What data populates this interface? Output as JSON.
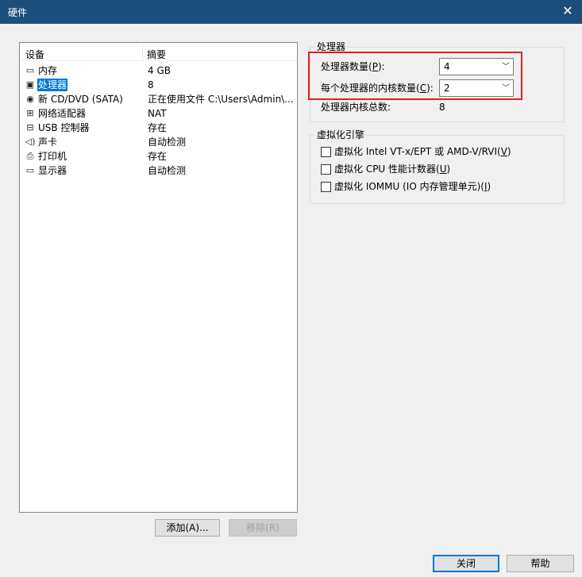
{
  "window": {
    "title": "硬件",
    "close_glyph": "✕"
  },
  "device_table": {
    "col_device": "设备",
    "col_summary": "摘要",
    "rows": [
      {
        "icon": "memory-icon",
        "glyph": "▭",
        "name": "内存",
        "summary": "4 GB",
        "selected": false
      },
      {
        "icon": "cpu-icon",
        "glyph": "▣",
        "name": "处理器",
        "summary": "8",
        "selected": true
      },
      {
        "icon": "cd-dvd-icon",
        "glyph": "◉",
        "name": "新 CD/DVD (SATA)",
        "summary": "正在使用文件 C:\\Users\\Admin\\...",
        "selected": false
      },
      {
        "icon": "network-adapter-icon",
        "glyph": "⊞",
        "name": "网络适配器",
        "summary": "NAT",
        "selected": false
      },
      {
        "icon": "usb-controller-icon",
        "glyph": "⊟",
        "name": "USB 控制器",
        "summary": "存在",
        "selected": false
      },
      {
        "icon": "sound-card-icon",
        "glyph": "◁)",
        "name": "声卡",
        "summary": "自动检测",
        "selected": false
      },
      {
        "icon": "printer-icon",
        "glyph": "⎙",
        "name": "打印机",
        "summary": "存在",
        "selected": false
      },
      {
        "icon": "display-icon",
        "glyph": "▭",
        "name": "显示器",
        "summary": "自动检测",
        "selected": false
      }
    ]
  },
  "buttons": {
    "add": "添加(A)...",
    "remove": "移除(R)",
    "close": "关闭",
    "help": "帮助"
  },
  "processor_group": {
    "legend": "处理器",
    "count_label_pre": "处理器数量(",
    "count_label_key": "P",
    "count_label_post": "):",
    "count_value": "4",
    "cores_label_pre": "每个处理器的内核数量(",
    "cores_label_key": "C",
    "cores_label_post": "):",
    "cores_value": "2",
    "total_label": "处理器内核总数:",
    "total_value": "8"
  },
  "virtualization_group": {
    "legend": "虚拟化引擎",
    "options": [
      {
        "pre": "虚拟化 Intel VT-x/EPT 或 AMD-V/RVI(",
        "key": "V",
        "post": ")",
        "checked": false
      },
      {
        "pre": "虚拟化 CPU 性能计数器(",
        "key": "U",
        "post": ")",
        "checked": false
      },
      {
        "pre": "虚拟化 IOMMU (IO 内存管理单元)(",
        "key": "I",
        "post": ")",
        "checked": false
      }
    ]
  },
  "colors": {
    "title_bar": "#1c4e7c",
    "selection": "#0078d7",
    "highlight_box": "#e02020"
  }
}
